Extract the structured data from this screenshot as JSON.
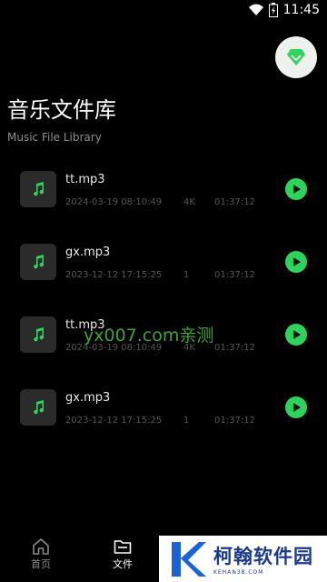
{
  "status_bar": {
    "time": "11:45",
    "icons": [
      "wifi-icon",
      "battery-icon"
    ]
  },
  "header": {
    "title": "音乐文件库",
    "subtitle": "Music File Library",
    "premium_icon": "diamond-icon"
  },
  "files": [
    {
      "name": "tt.mp3",
      "date": "2024-03-19 08:10:49",
      "size": "4K",
      "duration": "01:37:12"
    },
    {
      "name": "gx.mp3",
      "date": "2023-12-12 17:15:25",
      "size": "1",
      "duration": "01:37:12"
    },
    {
      "name": "tt.mp3",
      "date": "2024-03-19 08:10:49",
      "size": "4K",
      "duration": "01:37:12"
    },
    {
      "name": "gx.mp3",
      "date": "2023-12-12 17:15:25",
      "size": "1",
      "duration": "01:37:12"
    }
  ],
  "watermark": "yx007.com亲测",
  "nav": {
    "items": [
      {
        "label": "首页",
        "icon": "home-icon"
      },
      {
        "label": "文件",
        "icon": "folder-icon"
      }
    ]
  },
  "logo": {
    "text": "柯翰软件园",
    "sub": "KEHAN38.COM"
  },
  "colors": {
    "accent": "#2fd25a",
    "background": "#000000",
    "thumb": "#2b2b2b"
  }
}
